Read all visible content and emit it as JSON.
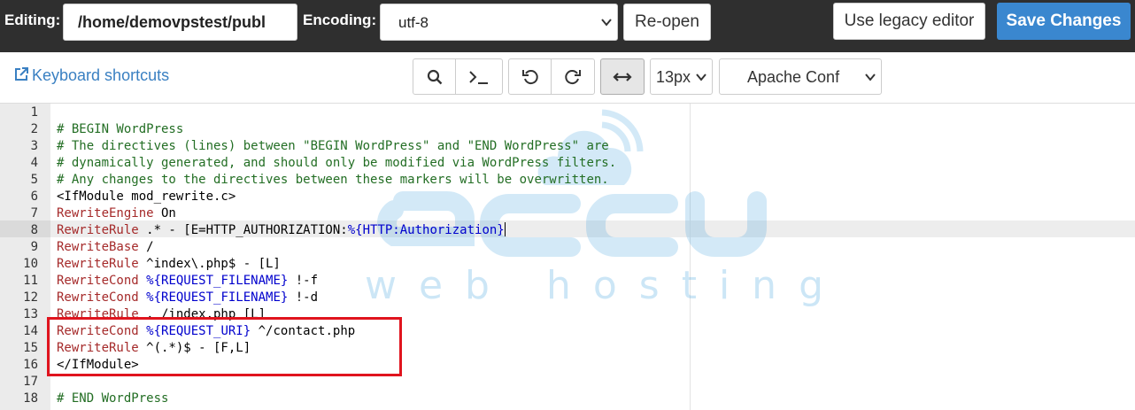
{
  "header": {
    "editing_label": "Editing:",
    "path_value": "/home/demovpstest/publ",
    "encoding_label": "Encoding:",
    "encoding_value": "utf-8",
    "reopen_label": "Re-open",
    "legacy_label": "Use legacy editor",
    "save_label": "Save Changes"
  },
  "toolbar": {
    "shortcuts_label": "Keyboard shortcuts",
    "font_size": "13px",
    "mode": "Apache Conf"
  },
  "colors": {
    "topbar": "#2f2f2f",
    "save_button": "#3a87cf",
    "link": "#3a80c2",
    "comment": "#236e24",
    "keyword": "#a52a2a",
    "variable": "#0000cd",
    "highlight_box": "#e0141e"
  },
  "editor": {
    "watermark": "web hosting",
    "active_line": 8,
    "lines": [
      {
        "n": "1",
        "parts": []
      },
      {
        "n": "2",
        "parts": [
          {
            "t": "# BEGIN WordPress",
            "c": "com"
          }
        ]
      },
      {
        "n": "3",
        "parts": [
          {
            "t": "# The directives (lines) between \"BEGIN WordPress\" and \"END WordPress\" are",
            "c": "com"
          }
        ]
      },
      {
        "n": "4",
        "parts": [
          {
            "t": "# dynamically generated, and should only be modified via WordPress filters.",
            "c": "com"
          }
        ]
      },
      {
        "n": "5",
        "parts": [
          {
            "t": "# Any changes to the directives between these markers will be overwritten.",
            "c": "com"
          }
        ]
      },
      {
        "n": "6",
        "parts": [
          {
            "t": "<IfModule mod_rewrite.c>",
            "c": ""
          }
        ]
      },
      {
        "n": "7",
        "parts": [
          {
            "t": "RewriteEngine",
            "c": "kw"
          },
          {
            "t": " On",
            "c": ""
          }
        ]
      },
      {
        "n": "8",
        "parts": [
          {
            "t": "RewriteRule",
            "c": "kw"
          },
          {
            "t": " .* - [E=HTTP_AUTHORIZATION:",
            "c": ""
          },
          {
            "t": "%{HTTP:Authorization}",
            "c": "var"
          }
        ]
      },
      {
        "n": "9",
        "parts": [
          {
            "t": "RewriteBase",
            "c": "kw"
          },
          {
            "t": " /",
            "c": ""
          }
        ]
      },
      {
        "n": "10",
        "parts": [
          {
            "t": "RewriteRule",
            "c": "kw"
          },
          {
            "t": " ^index\\.php$ - [L]",
            "c": ""
          }
        ]
      },
      {
        "n": "11",
        "parts": [
          {
            "t": "RewriteCond",
            "c": "kw"
          },
          {
            "t": " ",
            "c": ""
          },
          {
            "t": "%{REQUEST_FILENAME}",
            "c": "var"
          },
          {
            "t": " !-f",
            "c": ""
          }
        ]
      },
      {
        "n": "12",
        "parts": [
          {
            "t": "RewriteCond",
            "c": "kw"
          },
          {
            "t": " ",
            "c": ""
          },
          {
            "t": "%{REQUEST_FILENAME}",
            "c": "var"
          },
          {
            "t": " !-d",
            "c": ""
          }
        ]
      },
      {
        "n": "13",
        "parts": [
          {
            "t": "RewriteRule",
            "c": "kw"
          },
          {
            "t": " . /index.php [L]",
            "c": ""
          }
        ]
      },
      {
        "n": "14",
        "parts": [
          {
            "t": "RewriteCond",
            "c": "kw"
          },
          {
            "t": " ",
            "c": ""
          },
          {
            "t": "%{REQUEST_URI}",
            "c": "var"
          },
          {
            "t": " ^/contact.php",
            "c": ""
          }
        ]
      },
      {
        "n": "15",
        "parts": [
          {
            "t": "RewriteRule",
            "c": "kw"
          },
          {
            "t": " ^(.*)$ - [F,L]",
            "c": ""
          }
        ]
      },
      {
        "n": "16",
        "parts": [
          {
            "t": "</IfModule>",
            "c": ""
          }
        ]
      },
      {
        "n": "17",
        "parts": []
      },
      {
        "n": "18",
        "parts": [
          {
            "t": "# END WordPress",
            "c": "com"
          }
        ]
      }
    ]
  }
}
